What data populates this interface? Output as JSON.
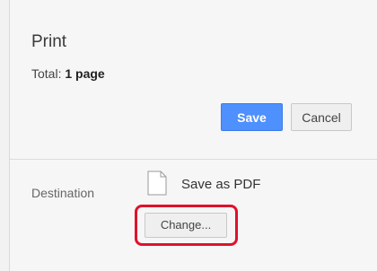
{
  "dialog": {
    "title": "Print",
    "total_label": "Total:",
    "total_value": "1 page"
  },
  "actions": {
    "save_label": "Save",
    "cancel_label": "Cancel"
  },
  "destination": {
    "label": "Destination",
    "value": "Save as PDF",
    "icon": "document-icon",
    "change_label": "Change..."
  },
  "colors": {
    "accent": "#4d90fe",
    "highlight": "#e0112b"
  }
}
